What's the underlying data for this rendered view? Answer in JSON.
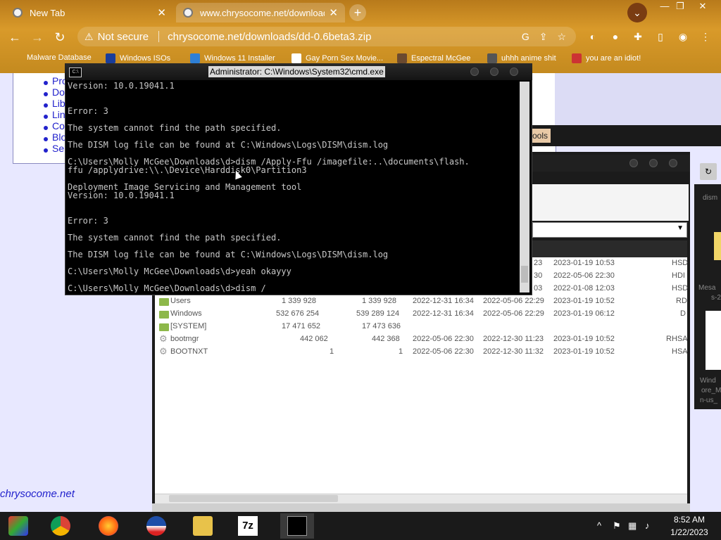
{
  "browser": {
    "tabs": [
      {
        "label": "New Tab",
        "active": false
      },
      {
        "label": "www.chrysocome.net/downloads/",
        "active": true
      }
    ],
    "new_tab_symbol": "+",
    "omnibox": {
      "security_label": "Not secure",
      "url": "chrysocome.net/downloads/dd-0.6beta3.zip"
    },
    "bookmarks": [
      "Malware Database",
      "Windows ISOs",
      "Windows 11 Installer",
      "Gay Porn Sex Movie...",
      "Espectral McGee",
      "uhhh anime shit",
      "you are an idiot!"
    ]
  },
  "webpage": {
    "nav_items_visible": [
      "Pro",
      "Do",
      "Lib",
      "Lin",
      "Co",
      "Blo",
      "Se"
    ],
    "site_link": "chrysocome.net"
  },
  "file_manager": {
    "tab_label": "ools",
    "partial_dates": [
      {
        "col1": "23",
        "col2": "2023-01-19 10:53",
        "attr": "HSD"
      },
      {
        "col1": "30",
        "col2": "2022-05-06 22:30",
        "attr": "HDI"
      },
      {
        "col1": "03",
        "col2": "2022-01-08 12:03",
        "attr": "HSD"
      }
    ],
    "rows": [
      {
        "name": "Users",
        "size": "1 339 928",
        "size2": "1 339 928",
        "d1": "2022-12-31 16:34",
        "d2": "2022-05-06 22:29",
        "d3": "2023-01-19 10:52",
        "attr": "RD",
        "kind": "folder"
      },
      {
        "name": "Windows",
        "size": "532 676 254",
        "size2": "539 289 124",
        "d1": "2022-12-31 16:34",
        "d2": "2022-05-06 22:29",
        "d3": "2023-01-19 06:12",
        "attr": "D",
        "kind": "folder"
      },
      {
        "name": "[SYSTEM]",
        "size": "17 471 652",
        "size2": "17 473 636",
        "d1": "",
        "d2": "",
        "d3": "",
        "attr": "",
        "kind": "folder"
      },
      {
        "name": "bootmgr",
        "size": "442 062",
        "size2": "442 368",
        "d1": "2022-05-06 22:30",
        "d2": "2022-12-30 11:23",
        "d3": "2023-01-19 10:52",
        "attr": "RHSA",
        "kind": "file"
      },
      {
        "name": "BOOTNXT",
        "size": "1",
        "size2": "1",
        "d1": "2022-05-06 22:30",
        "d2": "2022-12-30 11:32",
        "d3": "2023-01-19 10:52",
        "attr": "HSA",
        "kind": "file"
      }
    ],
    "side_labels": [
      "dism",
      "Mesa",
      "s-2",
      "Wind",
      "ore_M",
      "n-us_"
    ]
  },
  "cmd": {
    "title": "Administrator: C:\\Windows\\System32\\cmd.exe",
    "lines": [
      "Version: 10.0.19041.1",
      "",
      "",
      "Error: 3",
      "",
      "The system cannot find the path specified.",
      "",
      "The DISM log file can be found at C:\\Windows\\Logs\\DISM\\dism.log",
      "",
      "C:\\Users\\Molly McGee\\Downloads\\d>dism /Apply-Ffu /imagefile:..\\documents\\flash.",
      "ffu /applydrive:\\\\.\\Device\\Harddisk0\\Partition3",
      "",
      "Deployment Image Servicing and Management tool",
      "Version: 10.0.19041.1",
      "",
      "",
      "Error: 3",
      "",
      "The system cannot find the path specified.",
      "",
      "The DISM log file can be found at C:\\Windows\\Logs\\DISM\\dism.log",
      "",
      "C:\\Users\\Molly McGee\\Downloads\\d>yeah okayyy",
      "",
      "C:\\Users\\Molly McGee\\Downloads\\d>dism /"
    ]
  },
  "taskbar": {
    "apps": [
      "windows-start",
      "chrome",
      "firefox",
      "obama",
      "file-explorer",
      "7zip",
      "cmd"
    ],
    "app_7z_label": "7z",
    "time": "8:52 AM",
    "date": "1/22/2023"
  },
  "colors": {
    "chrome_frame": "#c48a1f",
    "page_bg": "#e8e8ff",
    "link": "#2222cc",
    "cmd_text": "#c8c8c8"
  }
}
